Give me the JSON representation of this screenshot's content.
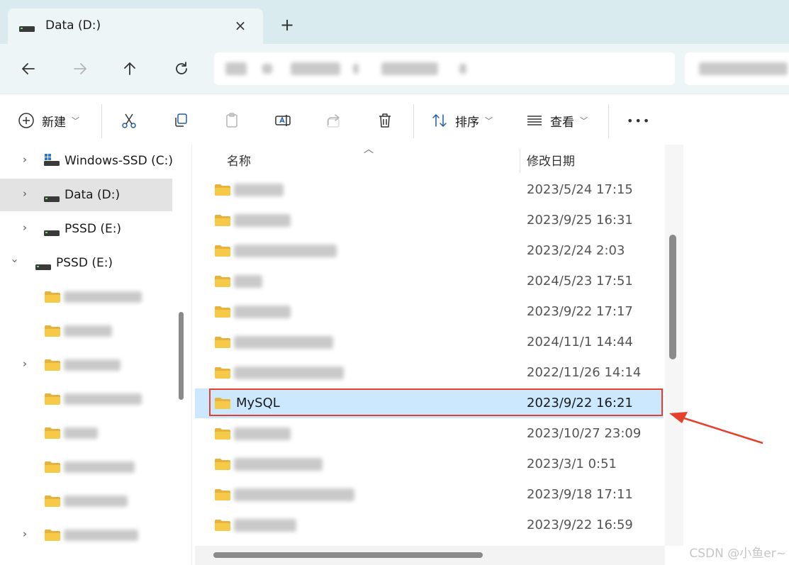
{
  "tab": {
    "title": "Data (D:)",
    "close_icon": "×",
    "new_tab_icon": "+"
  },
  "toolbar": {
    "new_label": "新建",
    "sort_label": "排序",
    "view_label": "查看",
    "more_label": "•••"
  },
  "nav_pane": {
    "items": [
      {
        "label": "Windows-SSD (C:)",
        "expanded": false,
        "selected": false
      },
      {
        "label": "Data (D:)",
        "expanded": false,
        "selected": true
      },
      {
        "label": "PSSD (E:)",
        "expanded": false,
        "selected": false
      },
      {
        "label": "PSSD (E:)",
        "expanded": true,
        "selected": false
      }
    ]
  },
  "file_list": {
    "columns": {
      "name": "名称",
      "date": "修改日期"
    },
    "rows": [
      {
        "name": "",
        "date": "2023/5/24 17:15"
      },
      {
        "name": "",
        "date": "2023/9/25 16:31"
      },
      {
        "name": "",
        "date": "2023/2/24 2:03"
      },
      {
        "name": "",
        "date": "2024/5/23 17:51"
      },
      {
        "name": "",
        "date": "2023/9/22 17:17"
      },
      {
        "name": "",
        "date": "2024/11/1 14:44"
      },
      {
        "name": "",
        "date": "2022/11/26 14:14"
      },
      {
        "name": "MySQL",
        "date": "2023/9/22 16:21",
        "highlighted": true
      },
      {
        "name": "",
        "date": "2023/10/27 23:09"
      },
      {
        "name": "",
        "date": "2023/3/1 0:51"
      },
      {
        "name": "",
        "date": "2023/9/18 17:11"
      },
      {
        "name": "",
        "date": "2023/9/22 16:59"
      }
    ]
  },
  "colors": {
    "tab_strip": "#d9ebee",
    "nav_bar": "#eef5f6",
    "highlight_row": "#cce8ff",
    "annotation": "#e5402b",
    "folder": "#f7c948"
  },
  "watermark": "CSDN @小鱼er~"
}
